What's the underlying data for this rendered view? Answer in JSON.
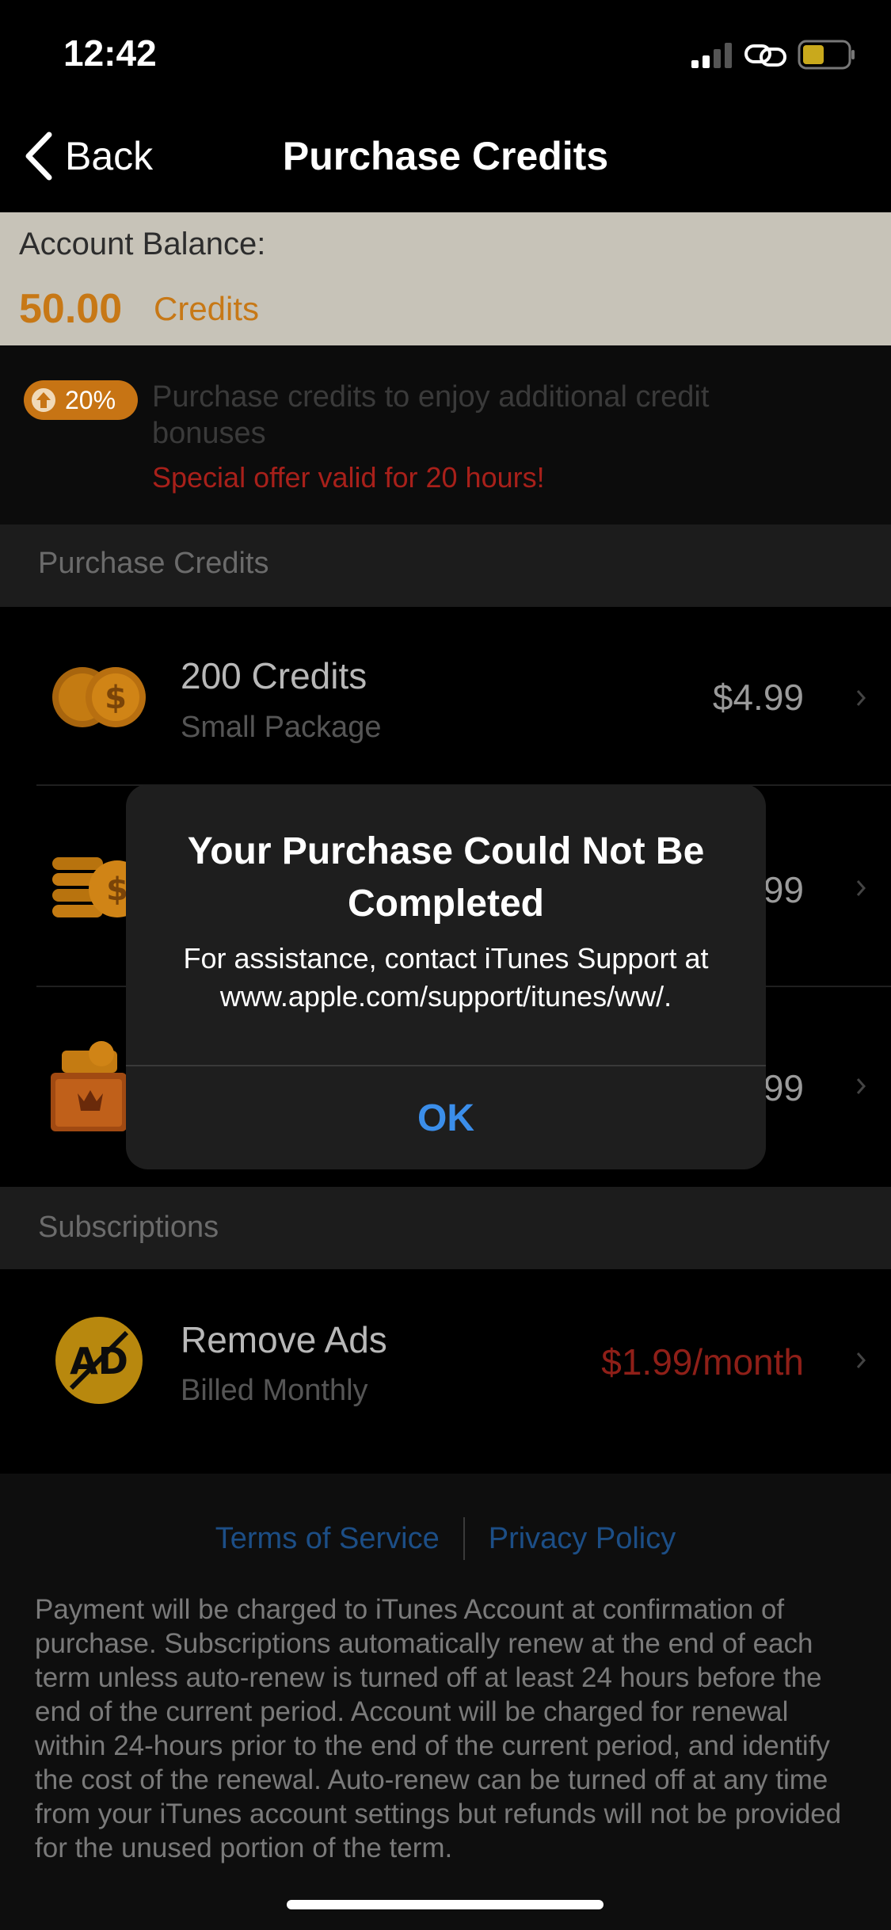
{
  "status_bar": {
    "time": "12:42"
  },
  "nav": {
    "back_label": "Back",
    "title": "Purchase Credits"
  },
  "balance": {
    "label": "Account Balance:",
    "amount": "50.00",
    "unit": "Credits"
  },
  "promo": {
    "badge": "20%",
    "text": "Purchase credits to enjoy additional credit bonuses",
    "offer": "Special offer valid for 20 hours!"
  },
  "sections": {
    "purchase_credits": "Purchase Credits",
    "subscriptions": "Subscriptions"
  },
  "packages": [
    {
      "title": "200 Credits",
      "subtitle": "Small Package",
      "price": "$4.99",
      "icon": "coins-icon"
    },
    {
      "title": "",
      "subtitle": "",
      "price": "99",
      "icon": "coin-stack-icon"
    },
    {
      "title": "",
      "subtitle": "",
      "price": "99",
      "icon": "treasure-chest-icon"
    }
  ],
  "subscription": {
    "title": "Remove Ads",
    "subtitle": "Billed Monthly",
    "price": "$1.99/month",
    "icon": "no-ads-icon"
  },
  "footer": {
    "terms": "Terms of Service",
    "privacy": "Privacy Policy",
    "legal": "Payment will be charged to iTunes Account at confirmation of purchase. Subscriptions automatically renew at the end of each term unless auto-renew is turned off at least 24 hours before the end of the current period. Account will be charged for renewal within 24-hours prior to the end of the current period, and identify the cost of the renewal. Auto-renew can be turned off at any time from your iTunes account settings but refunds will not be provided for the unused portion of the term."
  },
  "alert": {
    "title": "Your Purchase Could Not Be Completed",
    "message": "For assistance, contact iTunes Support at www.apple.com/support/itunes/ww/.",
    "ok": "OK"
  },
  "colors": {
    "accent": "#c77816",
    "link": "#3b8eea",
    "offer": "#a8201a"
  }
}
